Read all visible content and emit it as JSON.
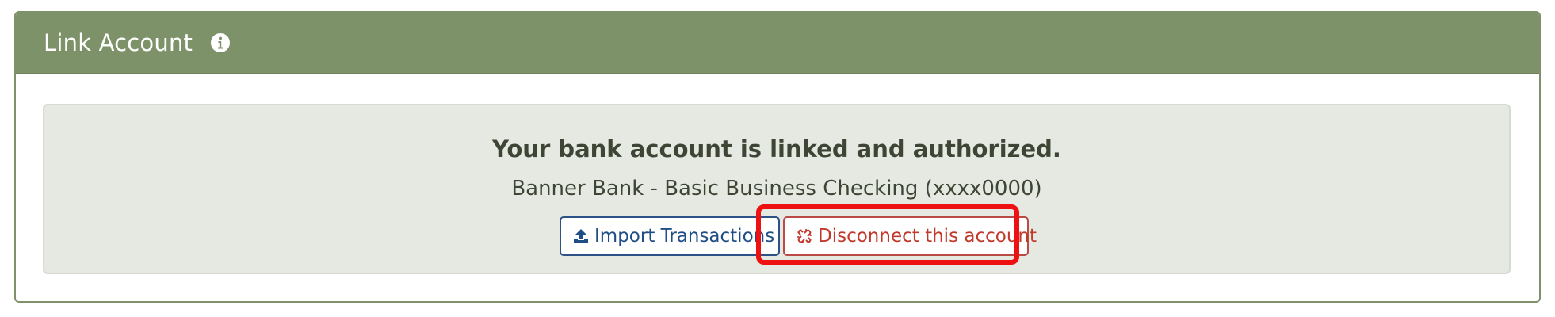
{
  "panel": {
    "title": "Link Account",
    "info_icon": "info-circle-icon"
  },
  "status": {
    "heading": "Your bank account is linked and authorized.",
    "account": "Banner Bank - Basic Business Checking (xxxx0000)"
  },
  "actions": {
    "import_label": "Import Transactions",
    "import_icon": "upload-icon",
    "disconnect_label": "Disconnect this account",
    "disconnect_icon": "unlink-icon"
  },
  "colors": {
    "header": "#7e926a",
    "well": "#e6e9e2",
    "primary": "#1f4d86",
    "danger": "#c0392b",
    "highlight": "#ee1111"
  }
}
